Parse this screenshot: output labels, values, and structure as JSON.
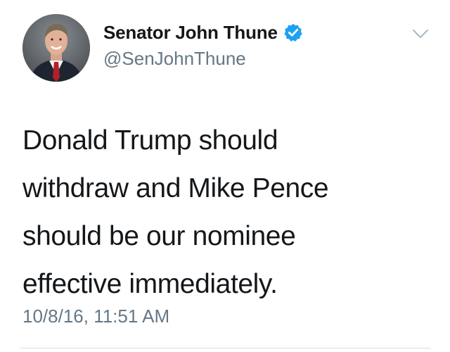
{
  "author": {
    "display_name": "Senator John Thune",
    "handle": "@SenJohnThune",
    "verified": true,
    "avatar_icon": "profile-photo"
  },
  "tweet": {
    "text_lines": [
      "Donald Trump should",
      "withdraw and Mike Pence",
      "should be our nominee",
      "effective immediately."
    ],
    "timestamp": "10/8/16, 11:51 AM"
  },
  "menu": {
    "icon": "chevron-down-icon"
  },
  "colors": {
    "text": "#14171a",
    "secondary": "#657786",
    "verified_badge": "#1da1f2",
    "divider": "#d8dde1"
  }
}
